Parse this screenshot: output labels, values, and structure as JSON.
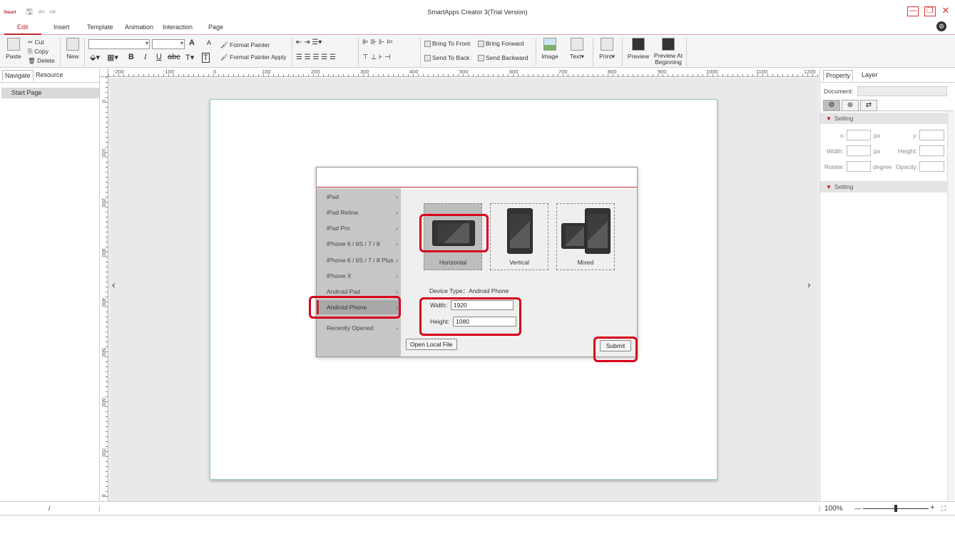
{
  "app": {
    "logo": "Smart",
    "title": "SmartApps Creator 3(Trial Version)"
  },
  "window_controls": {
    "minimize": "—",
    "restore": "❐",
    "close": "✕"
  },
  "menu_tabs": [
    "Edit",
    "Insert",
    "Template",
    "Animation",
    "Interaction",
    "Page"
  ],
  "ribbon": {
    "paste": "Paste",
    "cut": "Cut",
    "copy": "Copy",
    "delete": "Delete",
    "new": "New",
    "format_painter": "Format Painter",
    "format_painter_apply": "Format Painter Apply",
    "bring_to_front": "Bring To Front",
    "bring_forward": "Bring Forward",
    "send_to_back": "Send To Back",
    "send_backward": "Send Backward",
    "image": "Image",
    "text": "Text▾",
    "print": "Print▾",
    "preview": "Preview",
    "preview_at": "Preview At",
    "beginning": "Beginning",
    "bold": "B",
    "italic": "I",
    "underline": "U",
    "strike": "abc",
    "font_grow": "A",
    "font_shrink": "A"
  },
  "left_panel": {
    "tabs": [
      "Navigate",
      "Resource"
    ],
    "pages": [
      "Start Page"
    ]
  },
  "ruler": {
    "h_labels": [
      "-200",
      "-100",
      "0",
      "100",
      "200",
      "300",
      "400",
      "500",
      "600",
      "700",
      "800",
      "900",
      "1000",
      "1100",
      "1200"
    ],
    "v_labels": [
      "0",
      "100",
      "200",
      "300",
      "400",
      "500",
      "600",
      "700",
      "8"
    ]
  },
  "canvas": {
    "nav_prev": "‹",
    "nav_next": "›"
  },
  "dialog": {
    "devices": [
      {
        "label": "iPad",
        "chevron": "›"
      },
      {
        "label": "iPad Retina",
        "chevron": "›"
      },
      {
        "label": "iPad Pro",
        "chevron": "›"
      },
      {
        "label": "iPhone 6 / 6S / 7 / 8",
        "chevron": "›"
      },
      {
        "label": "iPhone 6 / 6S / 7 / 8 Plus",
        "chevron": "›"
      },
      {
        "label": "iPhone X",
        "chevron": "›"
      },
      {
        "label": "Android Pad",
        "chevron": "›"
      },
      {
        "label": "Android Phone",
        "chevron": "›"
      },
      {
        "label": "Recently Opened",
        "chevron": "›"
      }
    ],
    "selected_device": "Android Phone",
    "orientations": [
      "Horizontal",
      "Vertical",
      "Mixed"
    ],
    "selected_orientation": "Horizontal",
    "device_type_label": "Device Type：Android Phone",
    "width_label": "Width:",
    "width_value": "1920",
    "height_label": "Height:",
    "height_value": "1080",
    "open_local_file": "Open Local File",
    "submit": "Submit"
  },
  "right_panel": {
    "tabs": [
      "Property",
      "Layer"
    ],
    "document_label": "Document:",
    "icons": [
      "gear-icon",
      "palette-icon",
      "swap-icon"
    ],
    "icon_glyphs": [
      "⚙",
      "⊛",
      "⇄"
    ],
    "section1": "Setting",
    "section2": "Setting",
    "x_label": "x:",
    "px1": ":px",
    "y_label": "y:",
    "width_label": "Width:",
    "px2": ":px",
    "height_label": "Height:",
    "rotate_label": "Rotate:",
    "degree": "degree",
    "opacity_label": "Opacity:"
  },
  "status": {
    "page_indicator": "/",
    "zoom": "100%",
    "zoom_minus": "—",
    "zoom_plus": "+",
    "fit": "⛶"
  },
  "colors": {
    "accent": "#c0282d",
    "annotation": "#d9001b"
  }
}
